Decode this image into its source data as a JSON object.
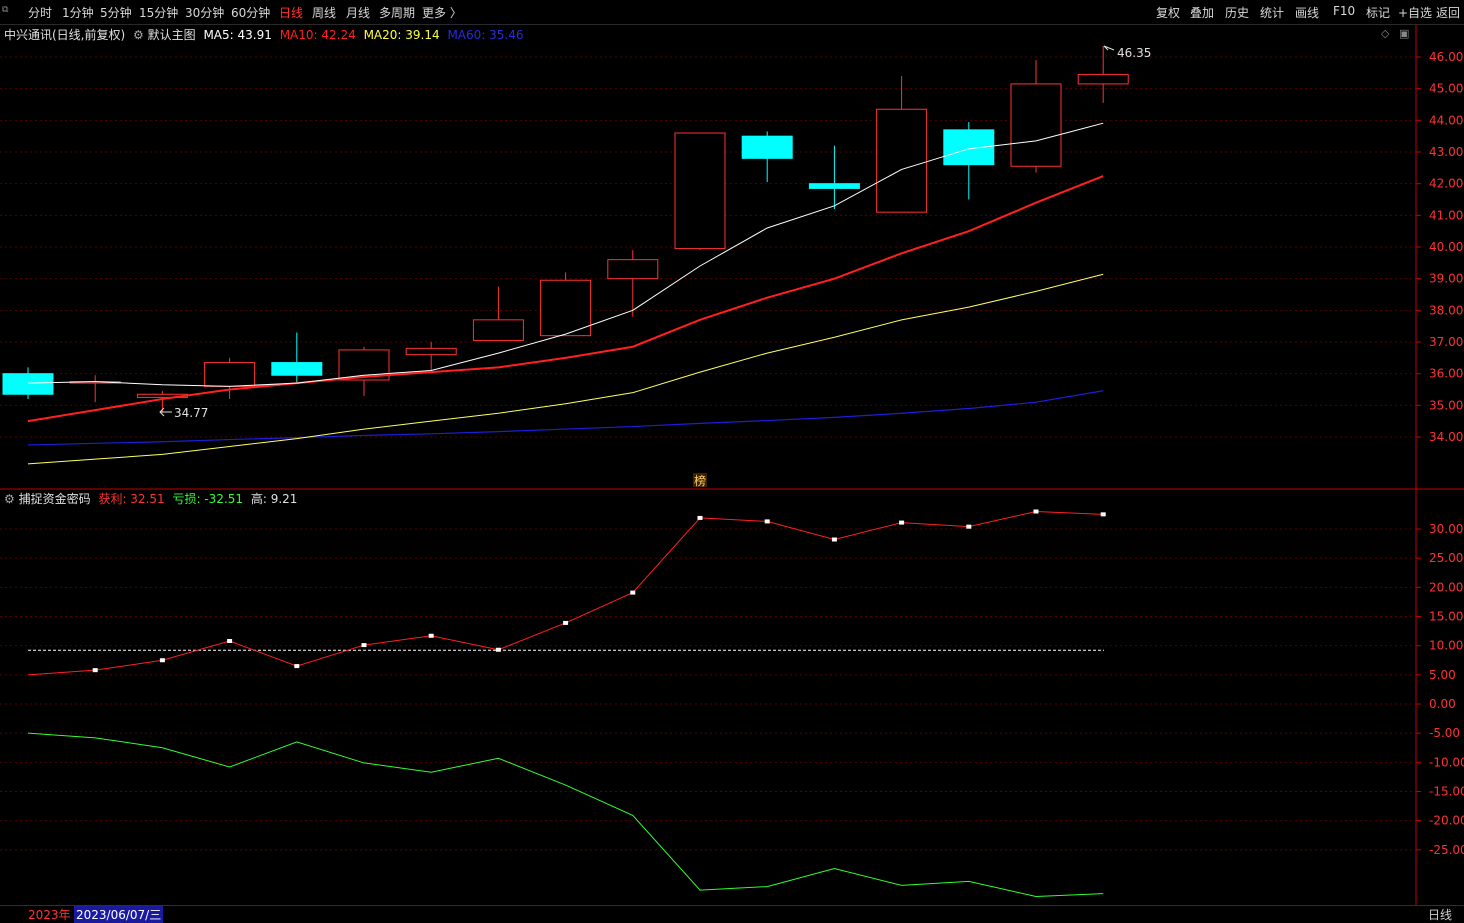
{
  "toolbar": {
    "left": [
      "分时",
      "1分钟",
      "5分钟",
      "15分钟",
      "30分钟",
      "60分钟",
      "日线",
      "周线",
      "月线",
      "多周期",
      "更多 〉"
    ],
    "active_index": 6,
    "right": [
      "复权",
      "叠加",
      "历史",
      "统计",
      "画线",
      "F10",
      "标记",
      "+自选",
      "返回"
    ]
  },
  "main_legend": {
    "stock": "中兴通讯(日线,前复权)",
    "template": "默认主图",
    "ma5": "MA5: 43.91",
    "ma10": "MA10: 42.24",
    "ma20": "MA20: 39.14",
    "ma60": "MA60: 35.46"
  },
  "sub_legend": {
    "name": "捕捉资金密码",
    "profit": "获利: 32.51",
    "loss": "亏损: -32.51",
    "high": "高: 9.21"
  },
  "annotations": {
    "high_label": "46.35",
    "low_label": "34.77",
    "marker_glyph": "榜"
  },
  "status": {
    "year": "2023年",
    "date": "2023/06/07/三",
    "period": "日线"
  },
  "colors": {
    "up": "#ff3232",
    "down": "#00ffff",
    "ma5": "#ffffff",
    "ma10": "#ff2020",
    "ma20": "#ffff60",
    "ma60": "#1e1ed8"
  },
  "chart_data": [
    {
      "type": "candlestick",
      "yticks": [
        "46.00",
        "45.00",
        "44.00",
        "43.00",
        "42.00",
        "41.00",
        "40.00",
        "39.00",
        "38.00",
        "37.00",
        "36.00",
        "35.00",
        "34.00"
      ],
      "ylim": [
        33.0,
        46.5
      ],
      "candles": [
        {
          "o": 36.0,
          "c": 35.35,
          "h": 36.2,
          "l": 35.2
        },
        {
          "o": 35.75,
          "c": 35.75,
          "h": 35.95,
          "l": 35.1
        },
        {
          "o": 35.25,
          "c": 35.35,
          "h": 35.45,
          "l": 34.77
        },
        {
          "o": 35.6,
          "c": 36.35,
          "h": 36.5,
          "l": 35.2
        },
        {
          "o": 36.35,
          "c": 35.95,
          "h": 37.3,
          "l": 35.7
        },
        {
          "o": 35.8,
          "c": 36.75,
          "h": 36.85,
          "l": 35.3
        },
        {
          "o": 36.6,
          "c": 36.8,
          "h": 37.0,
          "l": 36.1
        },
        {
          "o": 37.05,
          "c": 37.7,
          "h": 38.75,
          "l": 37.05
        },
        {
          "o": 37.2,
          "c": 38.95,
          "h": 39.2,
          "l": 37.2
        },
        {
          "o": 39.0,
          "c": 39.6,
          "h": 39.9,
          "l": 37.8
        },
        {
          "o": 39.95,
          "c": 43.6,
          "h": 43.6,
          "l": 39.9
        },
        {
          "o": 43.5,
          "c": 42.8,
          "h": 43.65,
          "l": 42.05
        },
        {
          "o": 42.0,
          "c": 41.85,
          "h": 43.2,
          "l": 41.2
        },
        {
          "o": 41.1,
          "c": 44.35,
          "h": 45.4,
          "l": 41.1
        },
        {
          "o": 43.7,
          "c": 42.6,
          "h": 43.95,
          "l": 41.5
        },
        {
          "o": 42.55,
          "c": 45.15,
          "h": 45.9,
          "l": 42.35
        },
        {
          "o": 45.15,
          "c": 45.45,
          "h": 46.35,
          "l": 44.55
        }
      ],
      "ma5": [
        35.7,
        35.75,
        35.65,
        35.6,
        35.7,
        35.95,
        36.1,
        36.65,
        37.25,
        38.0,
        39.4,
        40.6,
        41.3,
        42.45,
        43.1,
        43.35,
        43.91
      ],
      "ma10": [
        34.5,
        34.85,
        35.2,
        35.5,
        35.7,
        35.9,
        36.05,
        36.2,
        36.5,
        36.85,
        37.7,
        38.4,
        39.0,
        39.8,
        40.5,
        41.4,
        42.24
      ],
      "ma20": [
        33.15,
        33.3,
        33.45,
        33.7,
        33.95,
        34.25,
        34.5,
        34.75,
        35.05,
        35.4,
        36.05,
        36.65,
        37.15,
        37.7,
        38.1,
        38.6,
        39.14
      ],
      "ma60": [
        33.75,
        33.8,
        33.85,
        33.92,
        33.98,
        34.05,
        34.1,
        34.17,
        34.25,
        34.33,
        34.43,
        34.52,
        34.62,
        34.75,
        34.9,
        35.1,
        35.46
      ]
    },
    {
      "type": "line",
      "name": "捕捉资金密码",
      "yticks": [
        "30.00",
        "25.00",
        "20.00",
        "15.00",
        "10.00",
        "5.00",
        "0.00",
        "-5.00",
        "-10.00",
        "-15.00",
        "-20.00",
        "-25.00"
      ],
      "ylim": [
        -34.0,
        36.0
      ],
      "profit": [
        5.0,
        5.8,
        7.5,
        10.8,
        6.5,
        10.1,
        11.7,
        9.3,
        13.9,
        19.1,
        31.9,
        31.3,
        28.2,
        31.1,
        30.4,
        33.0,
        32.51
      ],
      "loss": [
        -5.0,
        -5.8,
        -7.5,
        -10.8,
        -6.5,
        -10.1,
        -11.7,
        -9.3,
        -13.9,
        -19.1,
        -31.9,
        -31.3,
        -28.2,
        -31.1,
        -30.4,
        -33.0,
        -32.51
      ],
      "high_line": 9.21
    }
  ]
}
